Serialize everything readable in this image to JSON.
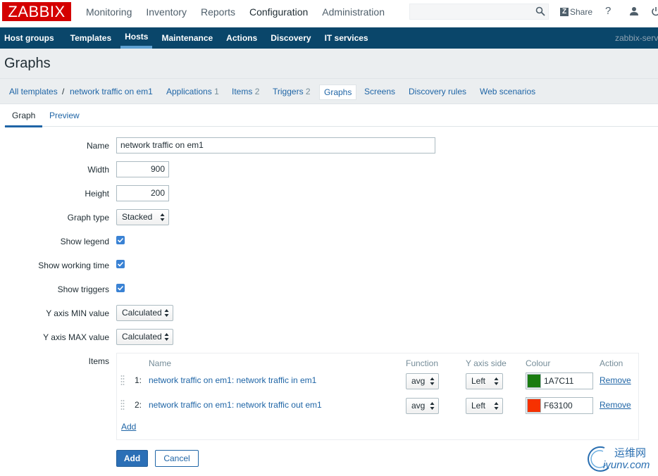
{
  "header": {
    "logo": "ZABBIX",
    "menu": [
      "Monitoring",
      "Inventory",
      "Reports",
      "Configuration",
      "Administration"
    ],
    "active_menu": "Configuration",
    "search_value": "",
    "share_label": "Share",
    "help_label": "?"
  },
  "submenu": {
    "items": [
      "Host groups",
      "Templates",
      "Hosts",
      "Maintenance",
      "Actions",
      "Discovery",
      "IT services"
    ],
    "active": "Hosts",
    "server": "zabbix-serv"
  },
  "page_title": "Graphs",
  "breadcrumbs": {
    "all_templates": "All templates",
    "separator": "/",
    "template": "network traffic on em1",
    "applications": "Applications",
    "applications_count": "1",
    "items": "Items",
    "items_count": "2",
    "triggers": "Triggers",
    "triggers_count": "2",
    "graphs": "Graphs",
    "screens": "Screens",
    "discovery_rules": "Discovery rules",
    "web_scenarios": "Web scenarios"
  },
  "tabs": {
    "graph": "Graph",
    "preview": "Preview"
  },
  "form": {
    "name_label": "Name",
    "name_value": "network traffic on em1",
    "width_label": "Width",
    "width_value": "900",
    "height_label": "Height",
    "height_value": "200",
    "graph_type_label": "Graph type",
    "graph_type_value": "Stacked",
    "show_legend_label": "Show legend",
    "show_legend_checked": true,
    "show_working_time_label": "Show working time",
    "show_working_time_checked": true,
    "show_triggers_label": "Show triggers",
    "show_triggers_checked": true,
    "ymin_label": "Y axis MIN value",
    "ymin_value": "Calculated",
    "ymax_label": "Y axis MAX value",
    "ymax_value": "Calculated",
    "items_label": "Items"
  },
  "items_table": {
    "headers": {
      "name": "Name",
      "function": "Function",
      "y_axis_side": "Y axis side",
      "colour": "Colour",
      "action": "Action"
    },
    "rows": [
      {
        "num": "1:",
        "name": "network traffic on em1: network traffic in em1",
        "function": "avg",
        "y_axis_side": "Left",
        "colour": "1A7C11",
        "colour_hex": "#1A7C11",
        "action": "Remove"
      },
      {
        "num": "2:",
        "name": "network traffic on em1: network traffic out em1",
        "function": "avg",
        "y_axis_side": "Left",
        "colour": "F63100",
        "colour_hex": "#F63100",
        "action": "Remove"
      }
    ],
    "add_link": "Add"
  },
  "buttons": {
    "add": "Add",
    "cancel": "Cancel"
  },
  "watermark": {
    "cn": "运维网",
    "en": "iyunv.com"
  },
  "colors": {
    "brand_red": "#d40000",
    "nav_blue": "#0a466a",
    "link_blue": "#1f65a6",
    "primary_button": "#2b6fb6"
  }
}
